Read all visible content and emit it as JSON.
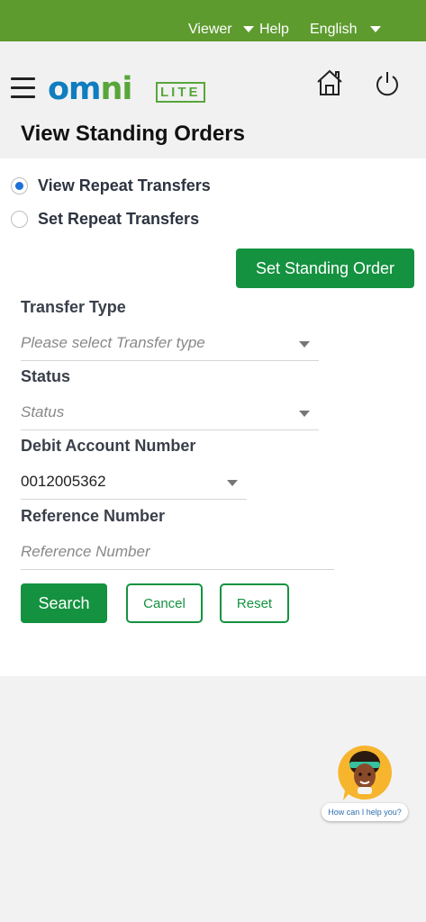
{
  "topbar": {
    "user_menu": "Viewer",
    "help": "Help",
    "language": "English"
  },
  "header": {
    "logo_main": "om",
    "logo_accent": "ni",
    "logo_badge": "LITE"
  },
  "page": {
    "title": "View Standing Orders"
  },
  "options": {
    "view_repeat": "View Repeat Transfers",
    "set_repeat": "Set Repeat Transfers",
    "selected": "View Repeat Transfers"
  },
  "actions": {
    "set_standing_order": "Set Standing Order",
    "search": "Search",
    "cancel": "Cancel",
    "reset": "Reset"
  },
  "form": {
    "transfer_type": {
      "label": "Transfer Type",
      "placeholder": "Please select Transfer type"
    },
    "status": {
      "label": "Status",
      "placeholder": "Status"
    },
    "debit_account": {
      "label": "Debit Account Number",
      "value": "0012005362"
    },
    "reference": {
      "label": "Reference Number",
      "placeholder": "Reference Number"
    }
  },
  "assistant": {
    "prompt": "How can I help you?"
  },
  "colors": {
    "brand_green": "#149240",
    "topbar_green": "#5e9b2f",
    "logo_blue": "#0f7dbf",
    "radio_blue": "#1f6fd8"
  }
}
